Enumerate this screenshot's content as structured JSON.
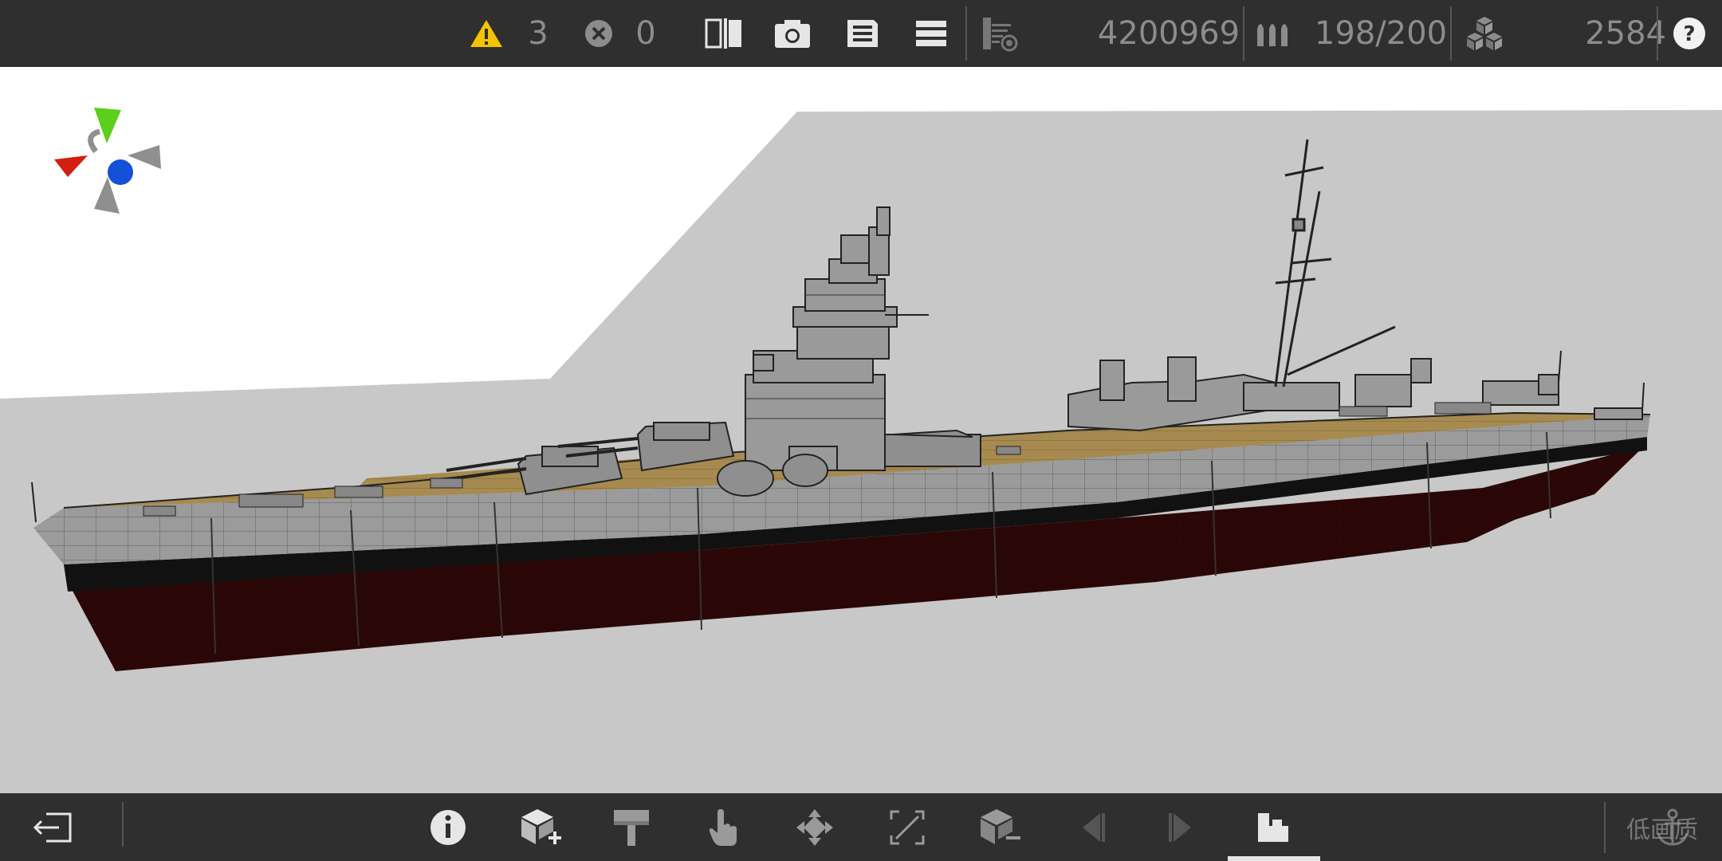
{
  "toolbar": {
    "warnings_count": "3",
    "errors_count": "0",
    "score": "4200969",
    "ammo": "198/200",
    "blocks_count": "2584",
    "icons": [
      "warning-icon",
      "error-icon",
      "mirror-icon",
      "screenshot-icon",
      "save-icon",
      "menu-icon",
      "layers-icon",
      "ammo-icon",
      "blocks-icon",
      "help-icon"
    ]
  },
  "bottom_bar": {
    "quality_label": "低画质",
    "icons": [
      "exit-icon",
      "info-icon",
      "add-block-icon",
      "paint-icon",
      "touch-icon",
      "move-icon",
      "scale-icon",
      "remove-block-icon",
      "prev-icon",
      "next-icon",
      "camera-mode-icon",
      "anchor-icon"
    ]
  },
  "colors": {
    "toolbar_bg": "#2f2f2f",
    "warning": "#f4c400",
    "deck": "#a68a4f",
    "hull_lower": "#2b0606",
    "hull_grey": "#9b9b9b",
    "gizmo_x": "#d41e0f",
    "gizmo_y": "#5bcf1a",
    "gizmo_z": "#1450d8"
  }
}
